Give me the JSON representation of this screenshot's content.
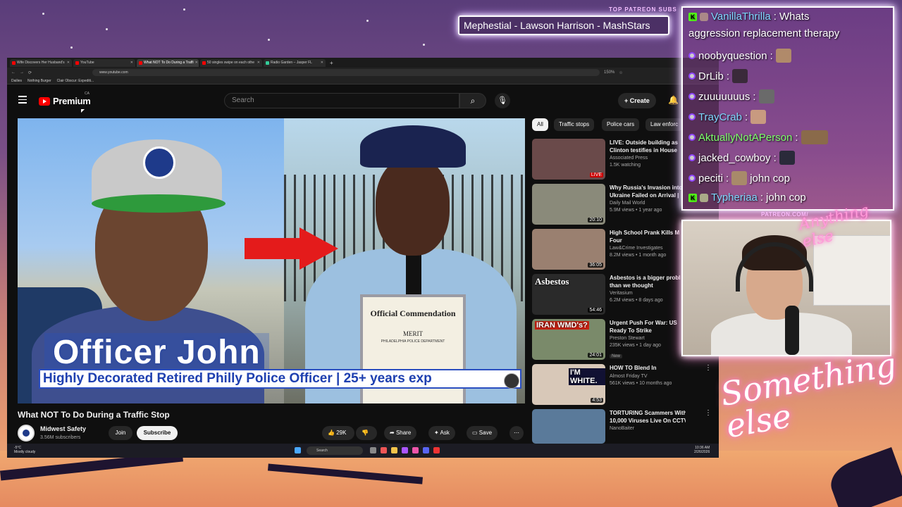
{
  "overlay": {
    "patreon_label": "TOP PATREON SUBS",
    "marquee_text": "Mephestial - Lawson Harrison - MashStars",
    "cam_label": "PATREON.COM/",
    "cam_brand": "Anything else",
    "signature": "Something else"
  },
  "browser": {
    "tabs": [
      {
        "label": "Wife Discovers Her Husband's",
        "active": false
      },
      {
        "label": "YouTube",
        "active": false
      },
      {
        "label": "What NOT To Do During a Traffi",
        "active": true
      },
      {
        "label": "50 singles swipe on each othe",
        "active": false
      },
      {
        "label": "Radio Garden – Jasper FL",
        "active": false
      }
    ],
    "new_tab": "+",
    "url": "www.youtube.com",
    "bookmarks": [
      "Dailies",
      "Nothing Burger",
      "Clair Obscur: Expediti..."
    ],
    "zoom": "150%"
  },
  "youtube": {
    "logo_text": "Premium",
    "region": "CA",
    "search_placeholder": "Search",
    "create_label": "Create",
    "video": {
      "overlay_title": "Officer John",
      "overlay_subtitle": "Highly Decorated Retired Philly Police Officer | 25+ years exp",
      "cert_title": "Official Commendation",
      "cert_subtitle": "MERIT",
      "cert_dept": "PHILADELPHIA POLICE DEPARTMENT"
    },
    "title": "What NOT To Do During a Traffic Stop",
    "channel": {
      "name": "Midwest Safety",
      "subscribers": "3.56M subscribers"
    },
    "join_label": "Join",
    "subscribe_label": "Subscribe",
    "like_count": "29K",
    "share_label": "Share",
    "ask_label": "Ask",
    "save_label": "Save",
    "chips": [
      "All",
      "Traffic stops",
      "Police cars",
      "Law enforc"
    ],
    "recommendations": [
      {
        "title": "LIVE: Outside building as",
        "title2": "Clinton testifies in House",
        "channel": "Associated Press",
        "meta": "1.5K watching",
        "duration": "LIVE",
        "thumb_text": "",
        "thumb_color": "#6a4a4a"
      },
      {
        "title": "Why Russia's Invasion into",
        "title2": "Ukraine Failed on Arrival |",
        "channel": "Daily Mail World",
        "meta": "5.9M views • 1 year ago",
        "duration": "20:10",
        "thumb_text": "",
        "thumb_color": "#8a8a7a"
      },
      {
        "title": "High School Prank Kills M",
        "title2": "Four",
        "channel": "Law&Crime Investigates",
        "meta": "8.2M views • 1 month ago",
        "duration": "36:05",
        "thumb_text": "",
        "thumb_color": "#9a8070"
      },
      {
        "title": "Asbestos is a bigger probl",
        "title2": "than we thought",
        "channel": "Veritasium",
        "meta": "6.2M views • 8 days ago",
        "duration": "54:46",
        "thumb_text": "Asbestos",
        "thumb_color": "#2a2a2a"
      },
      {
        "title": "Urgent Push For War: US",
        "title2": "Ready To Strike",
        "channel": "Preston Stewart",
        "meta": "235K views • 1 day ago",
        "duration": "24:01",
        "thumb_text": "IRAN WMD's?",
        "thumb_color": "#7a8a6a",
        "badge": "New"
      },
      {
        "title": "HOW TO Blend In",
        "title2": "",
        "channel": "Almost Friday TV",
        "meta": "561K views • 10 months ago",
        "duration": "4:53",
        "thumb_text": "I'M WHITE.",
        "thumb_color": "#d8c8b8"
      },
      {
        "title": "TORTURING Scammers With",
        "title2": "10,000 Viruses Live On CCTV!",
        "channel": "NanoBaiter",
        "meta": "",
        "duration": "",
        "thumb_text": "",
        "thumb_color": "#5a7a9a"
      }
    ]
  },
  "taskbar": {
    "weather_temp": "-5°C",
    "weather_desc": "Mostly cloudy",
    "search_label": "Search",
    "time": "10:36 AM",
    "date": "2/26/2026"
  },
  "chat": [
    {
      "user": "VanillaThrilla",
      "text": "Whats",
      "text2": "aggression replacement therapy",
      "badge": "kick",
      "color": "cyan"
    },
    {
      "user": "noobyquestion",
      "text": "",
      "badge": "twitch",
      "color": "white",
      "emote": true
    },
    {
      "user": "DrLib",
      "text": "",
      "badge": "twitch",
      "color": "white",
      "emote": true
    },
    {
      "user": "zuuuuuuus",
      "text": "",
      "badge": "twitch",
      "color": "white",
      "emote": true
    },
    {
      "user": "TrayCrab",
      "text": "",
      "badge": "twitch",
      "color": "cyan",
      "emote": true
    },
    {
      "user": "AktuallyNotAPerson",
      "text": "",
      "badge": "twitch",
      "color": "green",
      "emote": true
    },
    {
      "user": "jacked_cowboy",
      "text": "",
      "badge": "twitch",
      "color": "white",
      "emote": true
    },
    {
      "user": "peciti",
      "text": "john cop",
      "badge": "twitch",
      "color": "white",
      "emote": true
    },
    {
      "user": "Typheriaa",
      "text": "john cop",
      "badge": "kick",
      "color": "cyan",
      "emote": false
    }
  ]
}
